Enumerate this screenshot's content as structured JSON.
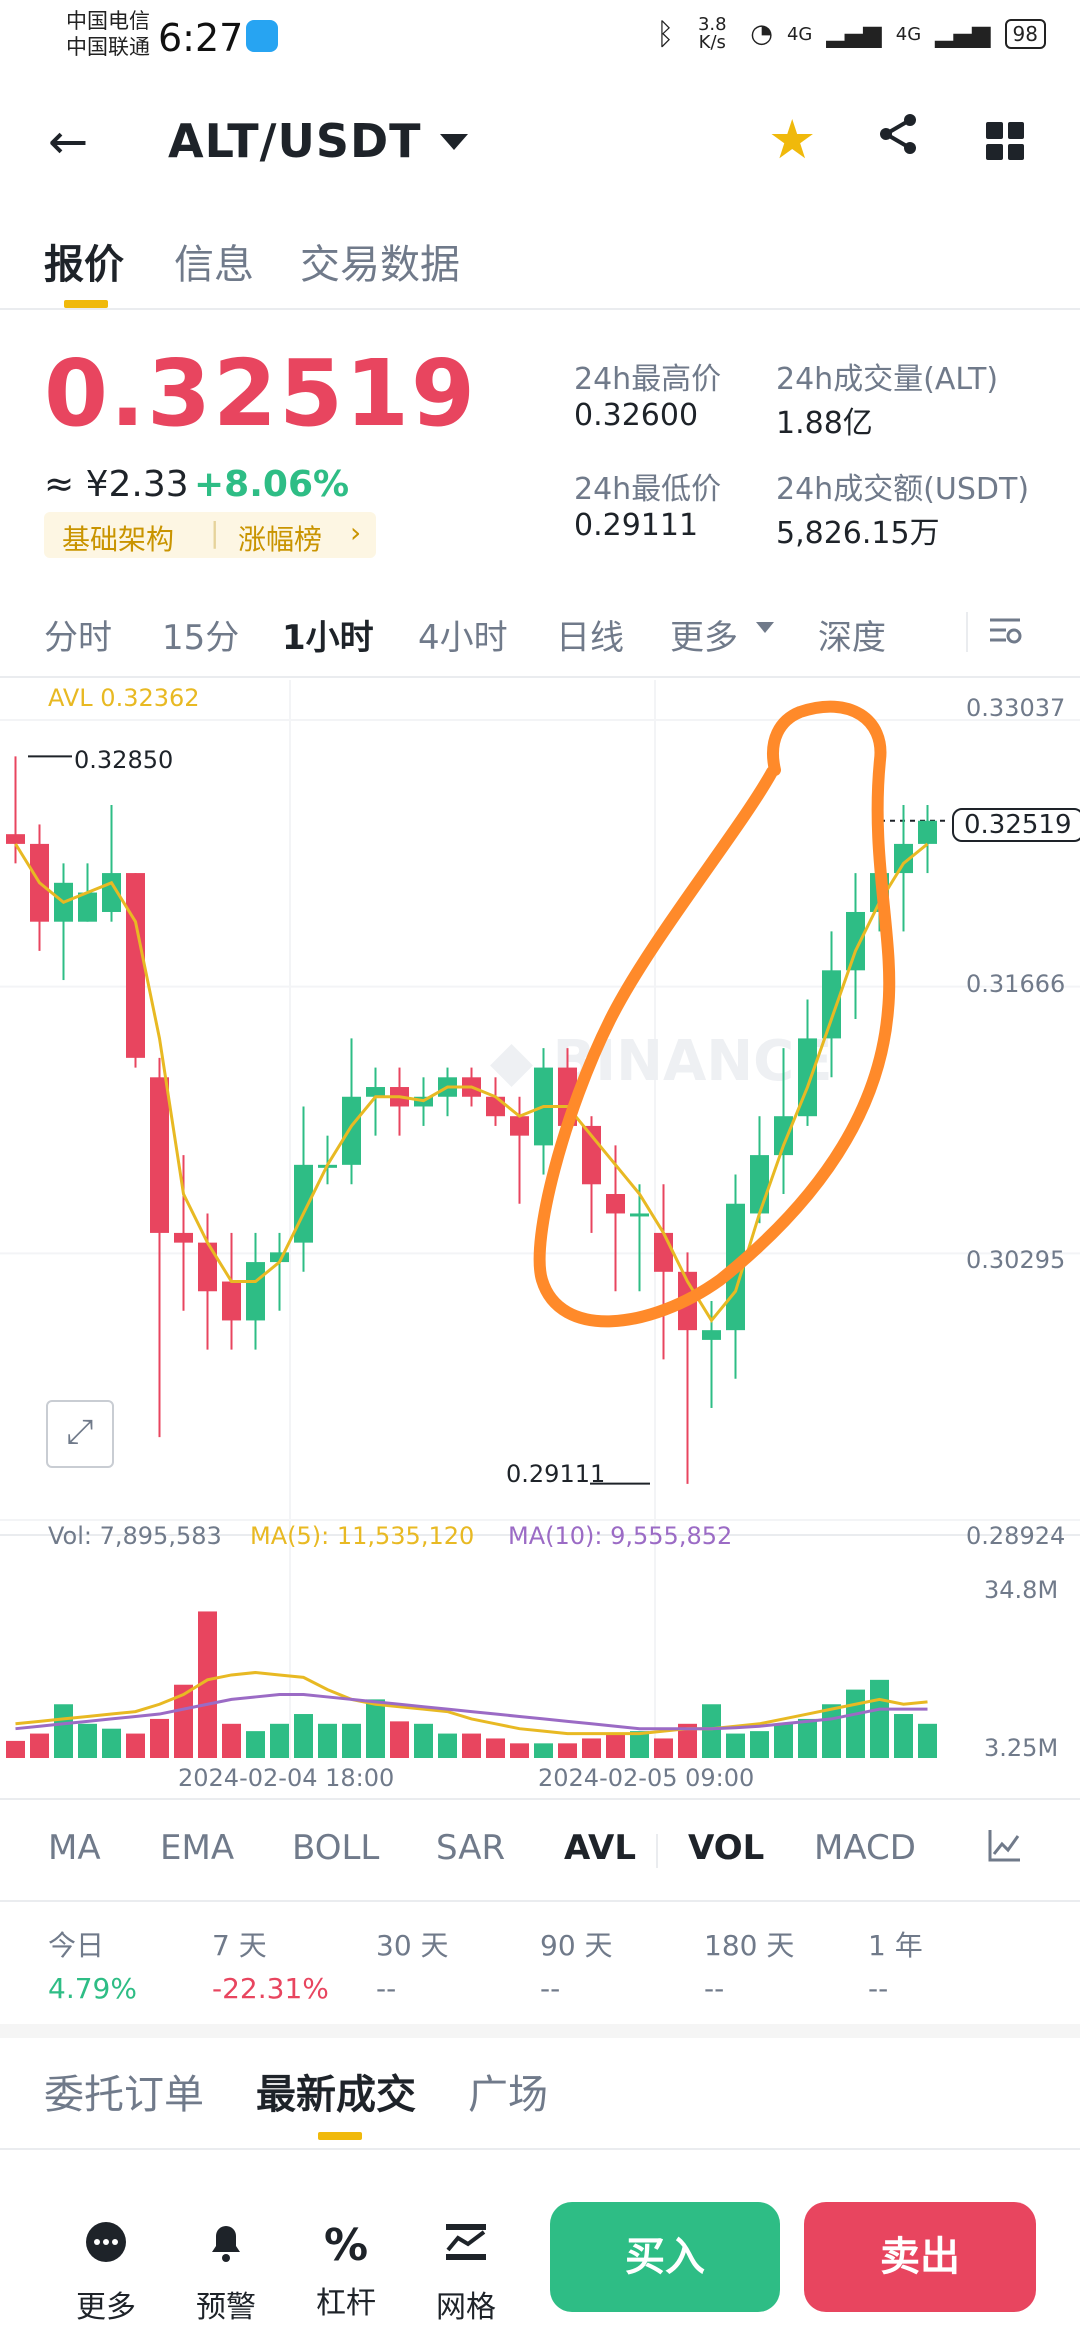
{
  "status_bar": {
    "carrier1": "中国电信",
    "carrier2": "中国联通",
    "time": "6:27",
    "net_speed": "3.8 K/s",
    "signal1": "4G",
    "signal2": "4G",
    "battery": "98"
  },
  "header": {
    "pair": "ALT/USDT"
  },
  "tabs": [
    "报价",
    "信息",
    "交易数据"
  ],
  "price": {
    "last": "0.32519",
    "cny": "≈ ¥2.33",
    "change": "+8.06%",
    "tag1": "基础架构",
    "tag2": "涨幅榜"
  },
  "stats": {
    "high_label": "24h最高价",
    "high": "0.32600",
    "vol_label": "24h成交量(ALT)",
    "vol": "1.88亿",
    "low_label": "24h最低价",
    "low": "0.29111",
    "amount_label": "24h成交额(USDT)",
    "amount": "5,826.15万"
  },
  "timeframes": [
    "分时",
    "15分",
    "1小时",
    "4小时",
    "日线",
    "更多",
    "深度"
  ],
  "chart_data": {
    "type": "candlestick",
    "avl_label": "AVL 0.32362",
    "y_ticks": [
      "0.33037",
      "0.31666",
      "0.30295",
      "0.28924"
    ],
    "ylim": [
      0.28924,
      0.33037
    ],
    "current_price": "0.32519",
    "high_marker": "0.32850",
    "low_marker": "0.29111",
    "x_labels": [
      "2024-02-04 18:00",
      "2024-02-05 09:00"
    ],
    "candles": [
      {
        "o": 0.3245,
        "h": 0.3285,
        "l": 0.323,
        "c": 0.324
      },
      {
        "o": 0.324,
        "h": 0.325,
        "l": 0.3185,
        "c": 0.32
      },
      {
        "o": 0.32,
        "h": 0.323,
        "l": 0.317,
        "c": 0.322
      },
      {
        "o": 0.32,
        "h": 0.323,
        "l": 0.32,
        "c": 0.3215
      },
      {
        "o": 0.3205,
        "h": 0.326,
        "l": 0.32,
        "c": 0.3225
      },
      {
        "o": 0.3225,
        "h": 0.3225,
        "l": 0.3125,
        "c": 0.313
      },
      {
        "o": 0.312,
        "h": 0.313,
        "l": 0.2935,
        "c": 0.304
      },
      {
        "o": 0.304,
        "h": 0.308,
        "l": 0.3,
        "c": 0.3035
      },
      {
        "o": 0.3035,
        "h": 0.305,
        "l": 0.298,
        "c": 0.301
      },
      {
        "o": 0.3015,
        "h": 0.304,
        "l": 0.298,
        "c": 0.2995
      },
      {
        "o": 0.2995,
        "h": 0.304,
        "l": 0.298,
        "c": 0.3025
      },
      {
        "o": 0.3025,
        "h": 0.304,
        "l": 0.3,
        "c": 0.303
      },
      {
        "o": 0.3035,
        "h": 0.3105,
        "l": 0.302,
        "c": 0.3075
      },
      {
        "o": 0.3075,
        "h": 0.309,
        "l": 0.3065,
        "c": 0.3075
      },
      {
        "o": 0.3075,
        "h": 0.314,
        "l": 0.3065,
        "c": 0.311
      },
      {
        "o": 0.311,
        "h": 0.3125,
        "l": 0.309,
        "c": 0.3115
      },
      {
        "o": 0.3115,
        "h": 0.3125,
        "l": 0.309,
        "c": 0.3105
      },
      {
        "o": 0.3105,
        "h": 0.312,
        "l": 0.3095,
        "c": 0.311
      },
      {
        "o": 0.311,
        "h": 0.3125,
        "l": 0.31,
        "c": 0.312
      },
      {
        "o": 0.312,
        "h": 0.3125,
        "l": 0.3105,
        "c": 0.311
      },
      {
        "o": 0.311,
        "h": 0.312,
        "l": 0.3095,
        "c": 0.31
      },
      {
        "o": 0.31,
        "h": 0.311,
        "l": 0.3055,
        "c": 0.309
      },
      {
        "o": 0.3085,
        "h": 0.3135,
        "l": 0.307,
        "c": 0.3125
      },
      {
        "o": 0.3125,
        "h": 0.3135,
        "l": 0.309,
        "c": 0.3095
      },
      {
        "o": 0.3095,
        "h": 0.31,
        "l": 0.304,
        "c": 0.3065
      },
      {
        "o": 0.306,
        "h": 0.3085,
        "l": 0.301,
        "c": 0.305
      },
      {
        "o": 0.305,
        "h": 0.3065,
        "l": 0.301,
        "c": 0.305
      },
      {
        "o": 0.304,
        "h": 0.3065,
        "l": 0.2975,
        "c": 0.302
      },
      {
        "o": 0.302,
        "h": 0.303,
        "l": 0.2911,
        "c": 0.299
      },
      {
        "o": 0.2985,
        "h": 0.3005,
        "l": 0.295,
        "c": 0.299
      },
      {
        "o": 0.299,
        "h": 0.307,
        "l": 0.2965,
        "c": 0.3055
      },
      {
        "o": 0.305,
        "h": 0.31,
        "l": 0.3045,
        "c": 0.308
      },
      {
        "o": 0.308,
        "h": 0.3135,
        "l": 0.306,
        "c": 0.31
      },
      {
        "o": 0.31,
        "h": 0.316,
        "l": 0.3095,
        "c": 0.314
      },
      {
        "o": 0.314,
        "h": 0.3195,
        "l": 0.312,
        "c": 0.3175
      },
      {
        "o": 0.3175,
        "h": 0.3225,
        "l": 0.315,
        "c": 0.3205
      },
      {
        "o": 0.3205,
        "h": 0.3235,
        "l": 0.3195,
        "c": 0.3225
      },
      {
        "o": 0.3225,
        "h": 0.326,
        "l": 0.3195,
        "c": 0.324
      },
      {
        "o": 0.324,
        "h": 0.326,
        "l": 0.3225,
        "c": 0.32519
      }
    ],
    "avl": [
      0.324,
      0.322,
      0.321,
      0.3215,
      0.322,
      0.32,
      0.314,
      0.306,
      0.3035,
      0.3015,
      0.3015,
      0.3025,
      0.305,
      0.3075,
      0.3095,
      0.311,
      0.311,
      0.3108,
      0.3115,
      0.3115,
      0.311,
      0.31,
      0.3105,
      0.3105,
      0.309,
      0.3075,
      0.306,
      0.304,
      0.3015,
      0.2995,
      0.301,
      0.305,
      0.3085,
      0.3115,
      0.315,
      0.3185,
      0.321,
      0.323,
      0.324
    ],
    "volume": {
      "vol_label": "Vol: 7,895,583",
      "ma5_label": "MA(5): 11,535,120",
      "ma10_label": "MA(10): 9,555,852",
      "y_ticks": [
        "34.8M",
        "3.25M"
      ],
      "bars": [
        3.5,
        5,
        11,
        7,
        6,
        5,
        8,
        15,
        30,
        7,
        5.5,
        7,
        9,
        7,
        7,
        12,
        7.5,
        7,
        5,
        5,
        4,
        3,
        3,
        3,
        4,
        5,
        5.5,
        4,
        7,
        11,
        5,
        5.5,
        7,
        8,
        11,
        14,
        16,
        9,
        7
      ],
      "ma5": [
        7,
        7.5,
        8,
        8.5,
        9,
        9.5,
        11,
        13,
        16,
        17,
        17.5,
        17,
        16.5,
        14,
        12,
        11,
        10.5,
        10,
        9.5,
        8,
        7,
        6,
        5.5,
        5,
        5,
        5,
        5,
        5.5,
        6,
        6,
        6.5,
        7,
        8,
        9,
        10,
        11,
        12,
        11,
        11.5
      ],
      "ma10": [
        6,
        6.5,
        7,
        7.5,
        8,
        8.5,
        9,
        10,
        11,
        12,
        12.5,
        13,
        13,
        12.5,
        12,
        11.5,
        11,
        10.5,
        10,
        9.5,
        9,
        8.5,
        8,
        7.5,
        7,
        6.5,
        6,
        6,
        6,
        6,
        6.2,
        6.5,
        7,
        7.5,
        8,
        9,
        10,
        10,
        10
      ]
    }
  },
  "indicators": [
    "MA",
    "EMA",
    "BOLL",
    "SAR",
    "AVL",
    "VOL",
    "MACD"
  ],
  "periods": [
    {
      "label": "今日",
      "value": "4.79%"
    },
    {
      "label": "7 天",
      "value": "-22.31%"
    },
    {
      "label": "30 天",
      "value": "--"
    },
    {
      "label": "90 天",
      "value": "--"
    },
    {
      "label": "180 天",
      "value": "--"
    },
    {
      "label": "1 年",
      "value": "--"
    }
  ],
  "colors": {
    "up": "#2ebd85",
    "down": "#e8455f",
    "accent": "#f0b90b",
    "avl_line": "#e8b923",
    "ma10": "#9b6bc5",
    "annotation": "#ff8a2a"
  },
  "bottom_tabs": [
    "委托订单",
    "最新成交",
    "广场"
  ],
  "bottom_nav": [
    "更多",
    "预警",
    "杠杆",
    "网格"
  ],
  "actions": {
    "buy": "买入",
    "sell": "卖出"
  }
}
